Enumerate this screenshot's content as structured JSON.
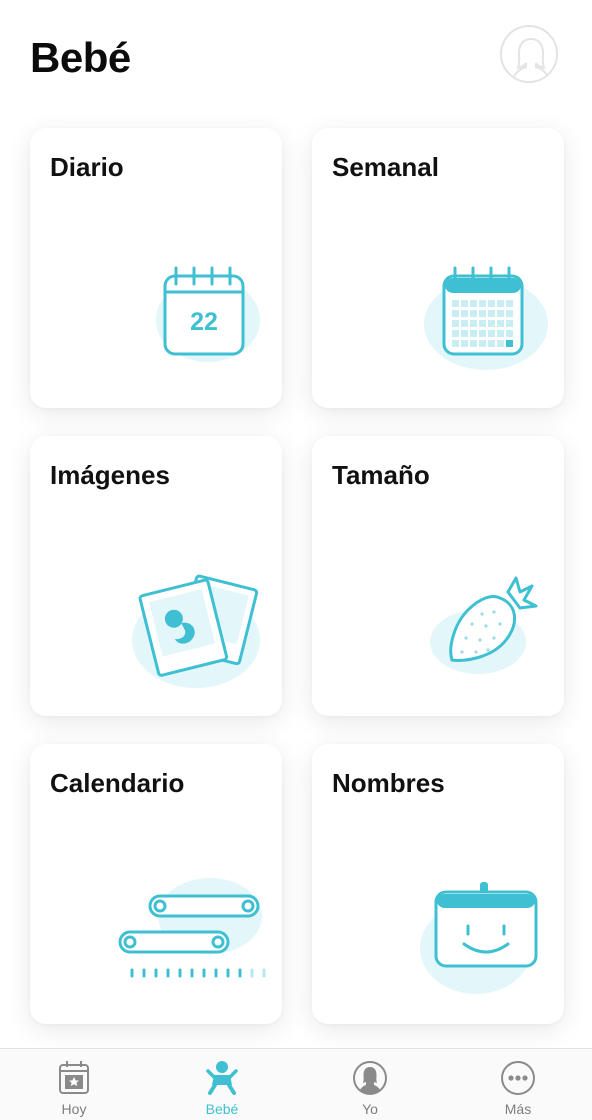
{
  "header": {
    "title": "Bebé"
  },
  "cards": [
    {
      "label": "Diario",
      "icon": "daily-calendar-icon",
      "day_number": "22"
    },
    {
      "label": "Semanal",
      "icon": "weekly-calendar-icon"
    },
    {
      "label": "Imágenes",
      "icon": "ultrasound-photos-icon"
    },
    {
      "label": "Tamaño",
      "icon": "strawberry-icon"
    },
    {
      "label": "Calendario",
      "icon": "timeline-icon"
    },
    {
      "label": "Nombres",
      "icon": "name-tag-icon"
    }
  ],
  "tabs": [
    {
      "label": "Hoy",
      "icon": "today-calendar-icon",
      "active": false
    },
    {
      "label": "Bebé",
      "icon": "baby-icon",
      "active": true
    },
    {
      "label": "Yo",
      "icon": "profile-icon",
      "active": false
    },
    {
      "label": "Más",
      "icon": "more-dots-icon",
      "active": false
    }
  ],
  "colors": {
    "accent": "#3fbfd2",
    "accent_light": "#e3f6f9",
    "inactive": "#7d7d7d",
    "card_background": "#ffffff"
  }
}
